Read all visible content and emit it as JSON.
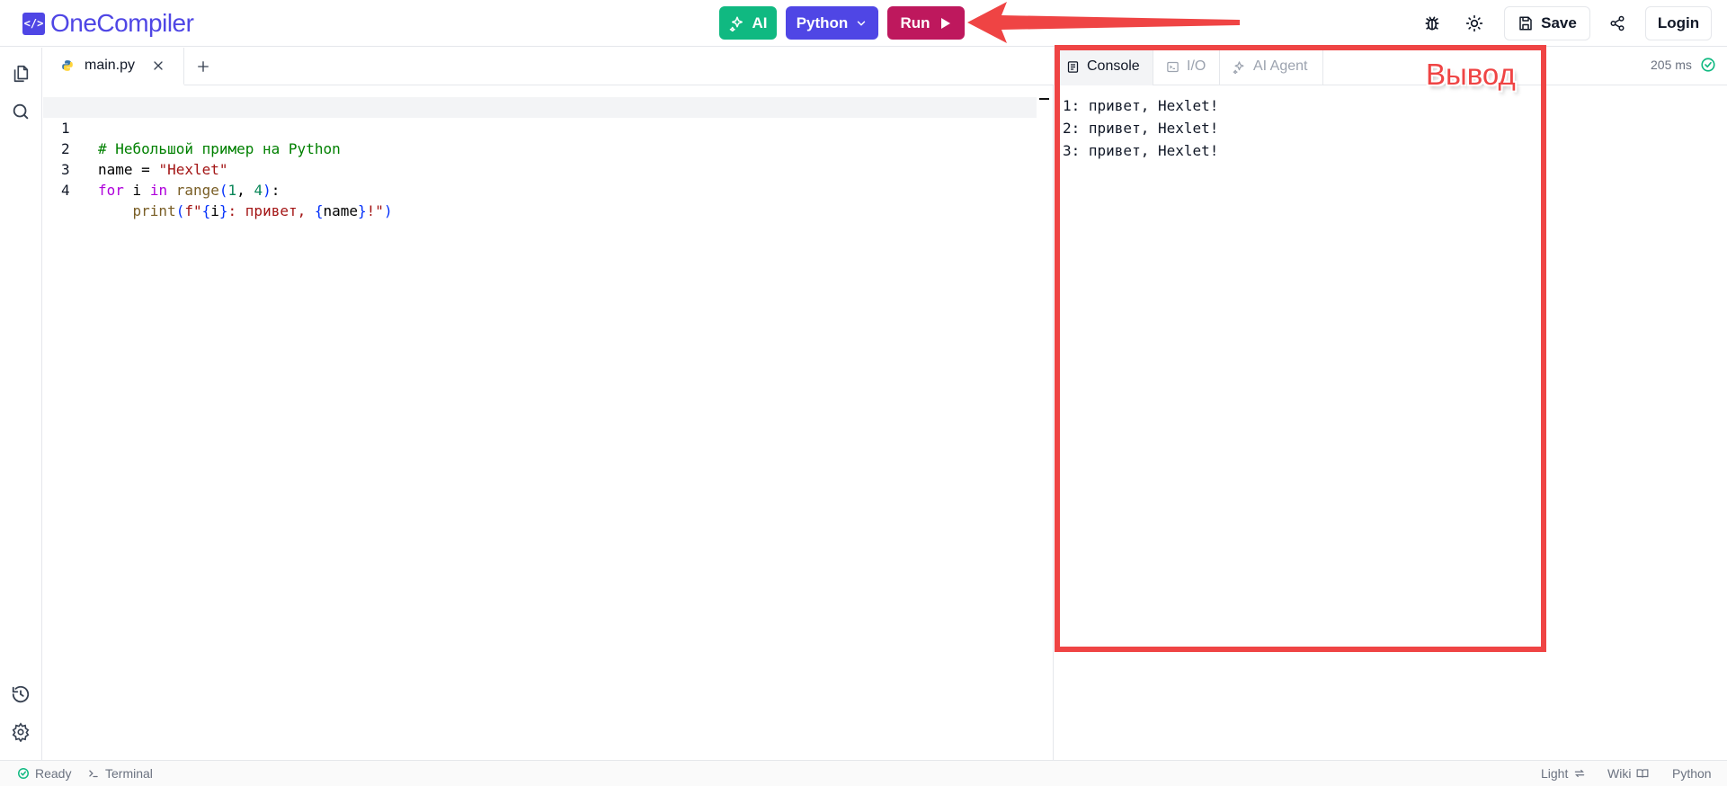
{
  "header": {
    "logo_mark": "</>",
    "logo_text": "OneCompiler",
    "ai_label": "AI",
    "language_label": "Python",
    "run_label": "Run",
    "save_label": "Save",
    "login_label": "Login"
  },
  "editor": {
    "tab_label": "main.py",
    "lines": [
      {
        "number": "1",
        "comment": "# Небольшой пример на Python"
      },
      {
        "number": "2",
        "var": "name",
        "op": " = ",
        "string": "\"Hexlet\""
      },
      {
        "number": "3",
        "kw1": "for",
        "sp1": " i ",
        "kw2": "in",
        "sp2": " ",
        "func": "range",
        "p1": "(",
        "n1": "1",
        "comma": ", ",
        "n2": "4",
        "p2": ")",
        "colon": ":"
      },
      {
        "number": "4",
        "indent": "    ",
        "func": "print",
        "p1": "(",
        "prefix": "f\"",
        "b1": "{",
        "v1": "i",
        "b2": "}",
        "mid": ": привет, ",
        "b3": "{",
        "v2": "name",
        "b4": "}",
        "end": "!\"",
        "p2": ")"
      }
    ]
  },
  "output": {
    "tabs": [
      "Console",
      "I/O",
      "AI Agent"
    ],
    "timing": "205 ms",
    "lines": [
      "1: привет, Hexlet!",
      "2: привет, Hexlet!",
      "3: привет, Hexlet!"
    ],
    "annotation_label": "Вывод"
  },
  "status": {
    "ready": "Ready",
    "terminal": "Terminal",
    "theme": "Light",
    "wiki": "Wiki",
    "language": "Python"
  },
  "colors": {
    "brand": "#4f46e5",
    "ai": "#10b981",
    "run": "#be185d",
    "annotation": "#ef4444"
  }
}
